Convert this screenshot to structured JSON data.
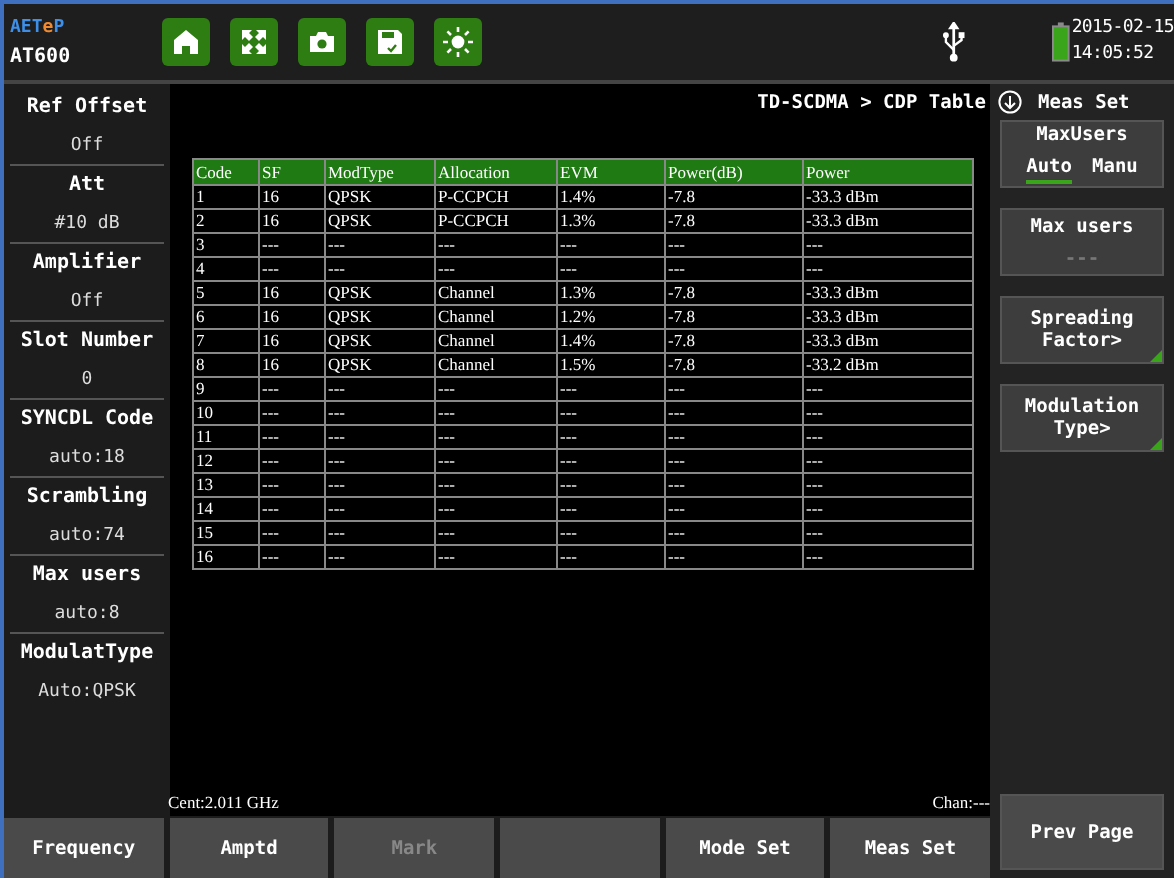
{
  "header": {
    "logo": [
      {
        "text": "AET",
        "color": "#3d8fe8"
      },
      {
        "text": "e",
        "color": "#f08a30"
      },
      {
        "text": "P",
        "color": "#3d8fe8"
      }
    ],
    "model": "AT600",
    "toolbar": [
      {
        "kind": "home"
      },
      {
        "kind": "expand"
      },
      {
        "kind": "camera"
      },
      {
        "kind": "save"
      },
      {
        "kind": "brightness"
      }
    ],
    "date": "2015-02-15",
    "time": "14:05:52"
  },
  "left_panel": [
    {
      "label": "Ref Offset",
      "value": "Off"
    },
    {
      "label": "Att",
      "value": "#10 dB"
    },
    {
      "label": "Amplifier",
      "value": "Off"
    },
    {
      "label": "Slot Number",
      "value": "0"
    },
    {
      "label": "SYNCDL Code",
      "value": "auto:18"
    },
    {
      "label": "Scrambling",
      "value": "auto:74"
    },
    {
      "label": "Max users",
      "value": "auto:8"
    },
    {
      "label": "ModulatType",
      "value": "Auto:QPSK"
    }
  ],
  "breadcrumb": "TD-SCDMA > CDP Table",
  "table": {
    "columns": [
      "Code",
      "SF",
      "ModType",
      "Allocation",
      "EVM",
      "Power(dB)",
      "Power"
    ],
    "rows": [
      [
        "1",
        "16",
        "QPSK",
        "P-CCPCH",
        "1.4%",
        "-7.8",
        "-33.3 dBm"
      ],
      [
        "2",
        "16",
        "QPSK",
        "P-CCPCH",
        "1.3%",
        "-7.8",
        "-33.3 dBm"
      ],
      [
        "3",
        "---",
        "---",
        "---",
        "---",
        "---",
        "---"
      ],
      [
        "4",
        "---",
        "---",
        "---",
        "---",
        "---",
        "---"
      ],
      [
        "5",
        "16",
        "QPSK",
        "Channel",
        "1.3%",
        "-7.8",
        "-33.3 dBm"
      ],
      [
        "6",
        "16",
        "QPSK",
        "Channel",
        "1.2%",
        "-7.8",
        "-33.3 dBm"
      ],
      [
        "7",
        "16",
        "QPSK",
        "Channel",
        "1.4%",
        "-7.8",
        "-33.3 dBm"
      ],
      [
        "8",
        "16",
        "QPSK",
        "Channel",
        "1.5%",
        "-7.8",
        "-33.2 dBm"
      ],
      [
        "9",
        "---",
        "---",
        "---",
        "---",
        "---",
        "---"
      ],
      [
        "10",
        "---",
        "---",
        "---",
        "---",
        "---",
        "---"
      ],
      [
        "11",
        "---",
        "---",
        "---",
        "---",
        "---",
        "---"
      ],
      [
        "12",
        "---",
        "---",
        "---",
        "---",
        "---",
        "---"
      ],
      [
        "13",
        "---",
        "---",
        "---",
        "---",
        "---",
        "---"
      ],
      [
        "14",
        "---",
        "---",
        "---",
        "---",
        "---",
        "---"
      ],
      [
        "15",
        "---",
        "---",
        "---",
        "---",
        "---",
        "---"
      ],
      [
        "16",
        "---",
        "---",
        "---",
        "---",
        "---",
        "---"
      ]
    ]
  },
  "center_freq": "Cent:2.011 GHz",
  "channel": "Chan:---",
  "right_panel": {
    "title": "Meas Set",
    "buttons": [
      {
        "kind": "toggle",
        "label": "MaxUsers",
        "options": [
          {
            "label": "Auto",
            "selected": true
          },
          {
            "label": "Manu",
            "selected": false
          }
        ]
      },
      {
        "kind": "value",
        "label": "Max users",
        "value": "---",
        "disabled": true
      },
      {
        "kind": "menu",
        "label": "Spreading Factor>",
        "submenu": true
      },
      {
        "kind": "menu",
        "label": "Modulation Type>",
        "submenu": true
      }
    ],
    "bottom_button": "Prev Page"
  },
  "softkeys": [
    {
      "kind": "key",
      "label": "Frequency",
      "disabled": false
    },
    {
      "kind": "key",
      "label": "Amptd",
      "disabled": false
    },
    {
      "kind": "key",
      "label": "Mark",
      "disabled": true
    },
    {
      "kind": "blank"
    },
    {
      "kind": "key",
      "label": "Mode Set",
      "disabled": false
    },
    {
      "kind": "key",
      "label": "Meas Set",
      "disabled": false
    }
  ]
}
